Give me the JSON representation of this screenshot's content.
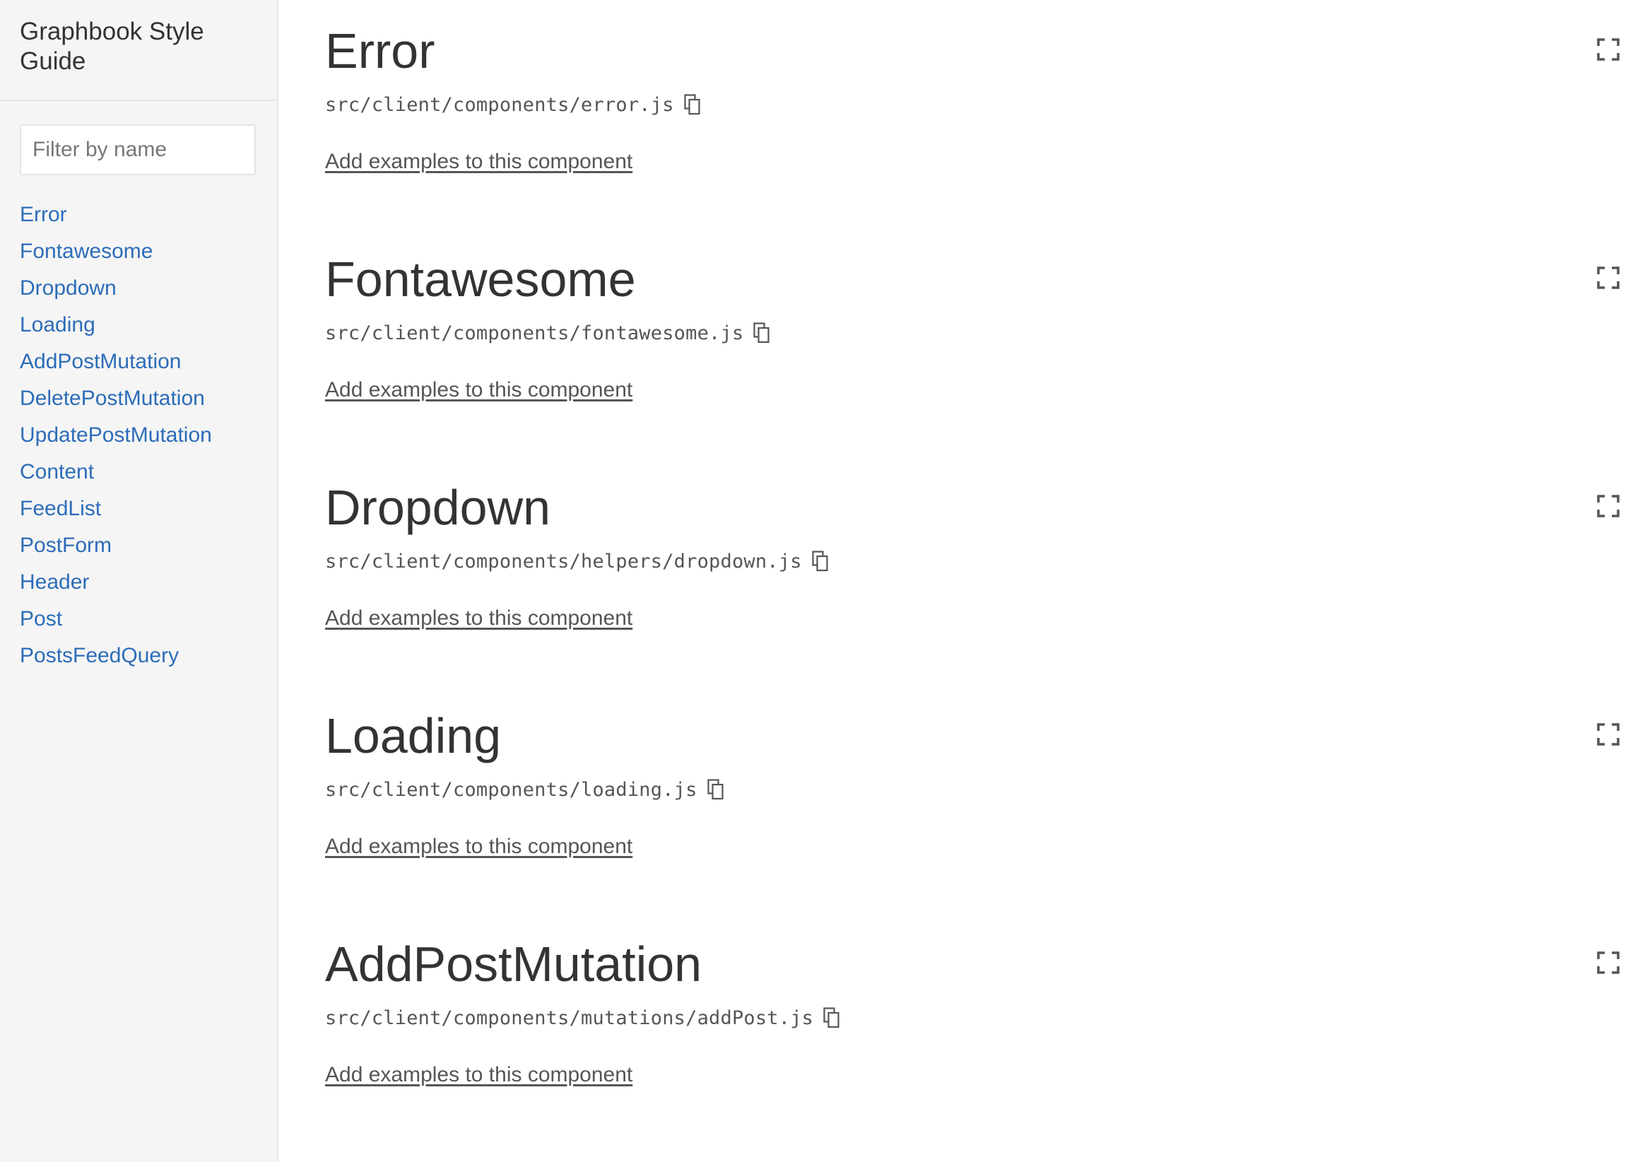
{
  "sidebar": {
    "title": "Graphbook Style Guide",
    "filter_placeholder": "Filter by name",
    "filter_value": "",
    "items": [
      {
        "label": "Error"
      },
      {
        "label": "Fontawesome"
      },
      {
        "label": "Dropdown"
      },
      {
        "label": "Loading"
      },
      {
        "label": "AddPostMutation"
      },
      {
        "label": "DeletePostMutation"
      },
      {
        "label": "UpdatePostMutation"
      },
      {
        "label": "Content"
      },
      {
        "label": "FeedList"
      },
      {
        "label": "PostForm"
      },
      {
        "label": "Header"
      },
      {
        "label": "Post"
      },
      {
        "label": "PostsFeedQuery"
      }
    ]
  },
  "components": [
    {
      "name": "Error",
      "path": "src/client/components/error.js",
      "examples_link": "Add examples to this component"
    },
    {
      "name": "Fontawesome",
      "path": "src/client/components/fontawesome.js",
      "examples_link": "Add examples to this component"
    },
    {
      "name": "Dropdown",
      "path": "src/client/components/helpers/dropdown.js",
      "examples_link": "Add examples to this component"
    },
    {
      "name": "Loading",
      "path": "src/client/components/loading.js",
      "examples_link": "Add examples to this component"
    },
    {
      "name": "AddPostMutation",
      "path": "src/client/components/mutations/addPost.js",
      "examples_link": "Add examples to this component"
    }
  ],
  "icons": {
    "copy": "copy-icon",
    "fullscreen": "fullscreen-icon"
  },
  "colors": {
    "link": "#2c6cb8",
    "text": "#333333",
    "muted": "#555555",
    "sidebar_bg": "#f5f5f5"
  }
}
